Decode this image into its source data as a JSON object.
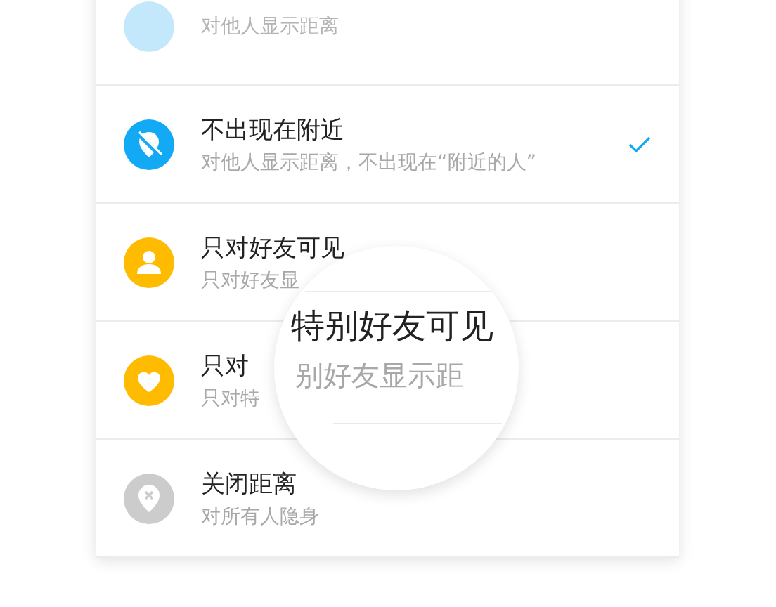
{
  "options": [
    {
      "kind": "blank",
      "color": "#c4e8fb",
      "subtitle": "对他人显示距离",
      "checked": false
    },
    {
      "kind": "pin-slash",
      "color": "#12aaf5",
      "title": "不出现在附近",
      "subtitle": "对他人显示距离，不出现在“附近的人”",
      "checked": true
    },
    {
      "kind": "person",
      "color": "#ffbb00",
      "title": "只对好友可见",
      "subtitle": "只对好友显",
      "checked": false
    },
    {
      "kind": "heart",
      "color": "#ffbb00",
      "title": "只对",
      "subtitle": "只对特",
      "checked": false
    },
    {
      "kind": "pin-x",
      "color": "#cccccc",
      "title": "关闭距离",
      "subtitle": "对所有人隐身",
      "checked": false
    }
  ],
  "magnifier": {
    "title": "特别好友可见",
    "subtitle": "别好友显示距"
  }
}
